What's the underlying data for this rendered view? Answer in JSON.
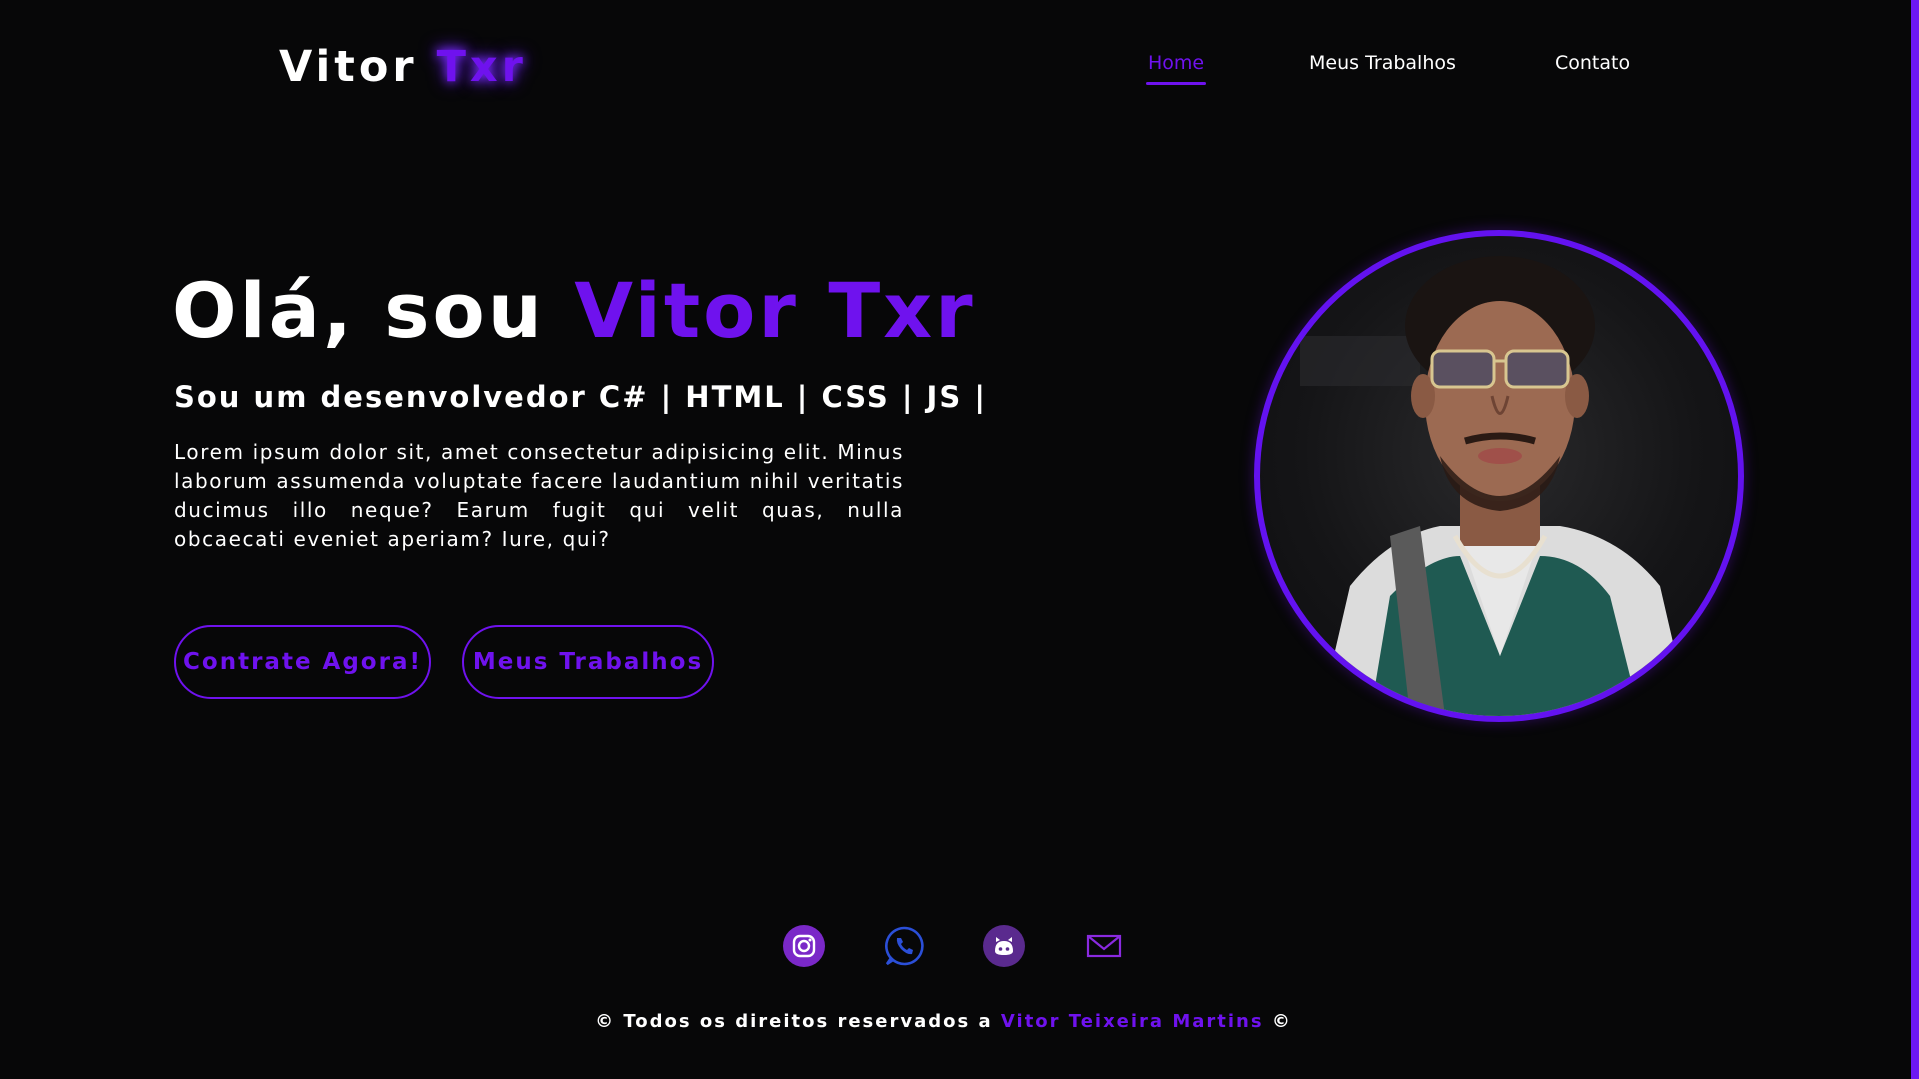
{
  "header": {
    "logo_first": "Vitor",
    "logo_accent": "Txr",
    "nav": [
      {
        "label": "Home",
        "active": true
      },
      {
        "label": "Meus Trabalhos",
        "active": false
      },
      {
        "label": "Contato",
        "active": false
      }
    ]
  },
  "hero": {
    "title_prefix": "Olá, sou",
    "title_accent": "Vitor Txr",
    "subtitle": "Sou um desenvolvedor C# | HTML | CSS | JS |",
    "description": "Lorem ipsum dolor sit, amet consectetur adipisicing elit. Minus laborum assumenda voluptate facere laudantium nihil veritatis ducimus illo neque? Earum fugit qui velit quas, nulla obcaecati eveniet aperiam? Iure, qui?",
    "buttons": {
      "hire": "Contrate Agora!",
      "works": "Meus Trabalhos"
    }
  },
  "social": [
    "instagram-icon",
    "whatsapp-icon",
    "github-icon",
    "email-icon"
  ],
  "footer": {
    "prefix": "© Todos os direitos reservados a",
    "name": "Vitor Teixeira Martins",
    "suffix": "©"
  },
  "colors": {
    "background": "#070708",
    "accent": "#6f12ee",
    "text": "#ffffff"
  }
}
